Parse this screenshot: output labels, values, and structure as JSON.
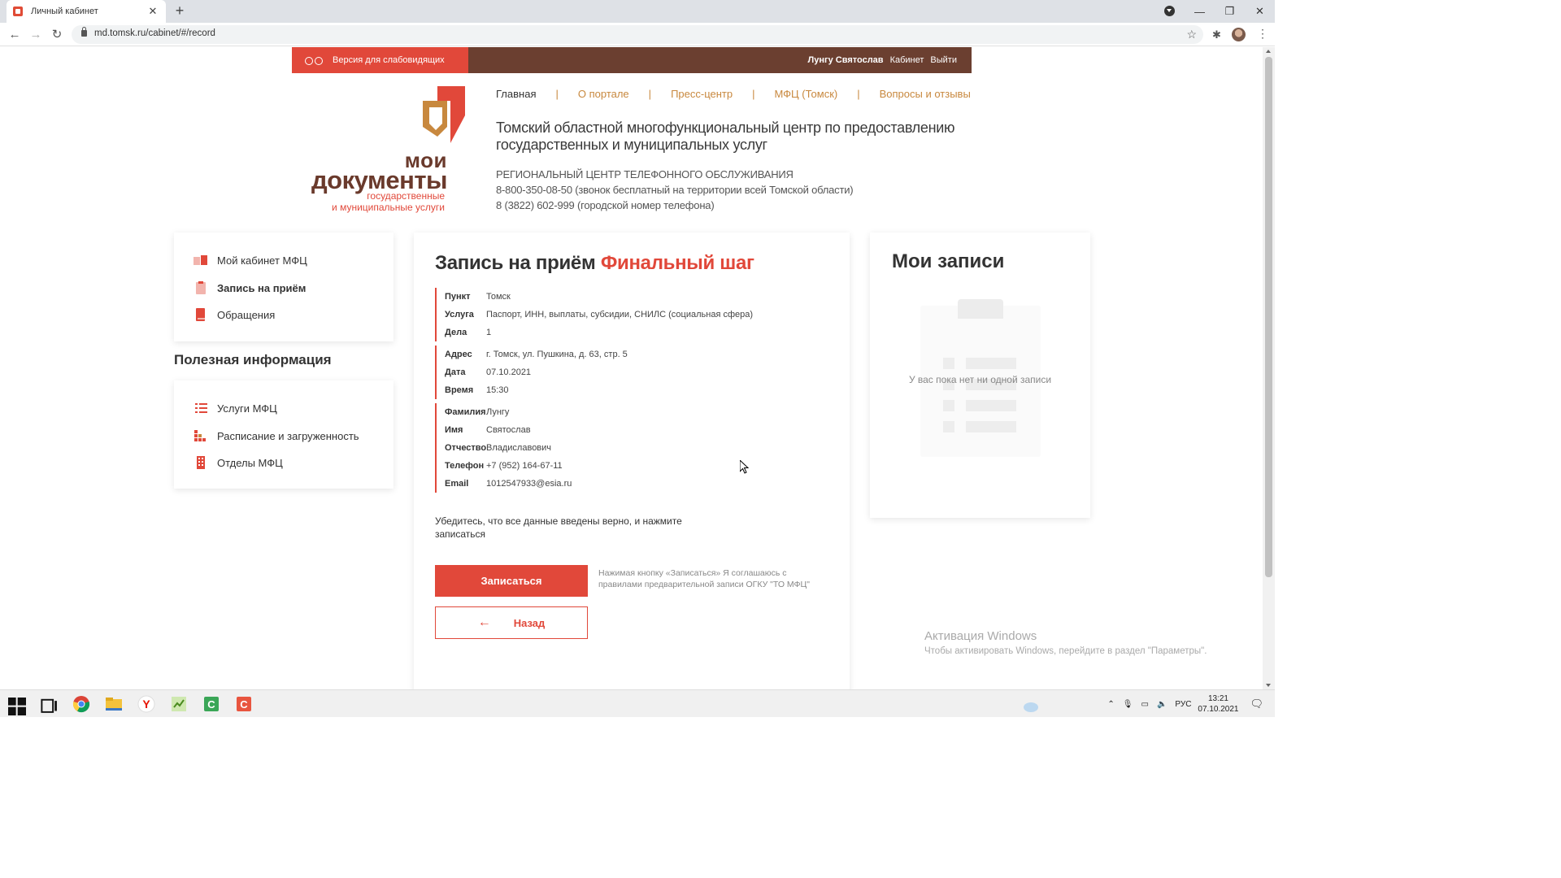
{
  "browser": {
    "tab_title": "Личный кабинет",
    "url": "md.tomsk.ru/cabinet/#/record"
  },
  "topbar": {
    "vision_label": "Версия для слабовидящих",
    "user_name": "Лунгу Святослав",
    "cabinet_link": "Кабинет",
    "logout_link": "Выйти"
  },
  "logo": {
    "line1": "мои",
    "line2": "документы",
    "line3": "государственные",
    "line4": "и муниципальные услуги"
  },
  "nav": {
    "items": [
      "Главная",
      "О портале",
      "Пресс-центр",
      "МФЦ (Томск)",
      "Вопросы и отзывы"
    ],
    "separator": "|"
  },
  "header": {
    "title": "Томский областной многофункциональный центр по предоставлению государственных и муниципальных услуг",
    "call_center": "РЕГИОНАЛЬНЫЙ ЦЕНТР ТЕЛЕФОННОГО ОБСЛУЖИВАНИЯ",
    "phone1": "8-800-350-08-50 (звонок бесплатный на территории всей Томской области)",
    "phone2": "8 (3822) 602-999 (городской номер телефона)"
  },
  "sidebar": {
    "items": [
      "Мой кабинет МФЦ",
      "Запись на приём",
      "Обращения"
    ],
    "useful_title": "Полезная информация",
    "useful_items": [
      "Услуги МФЦ",
      "Расписание и загруженность",
      "Отделы МФЦ"
    ]
  },
  "main": {
    "title": "Запись на приём",
    "title_accent": "Финальный шаг",
    "groups": [
      [
        [
          "Пункт",
          "Томск"
        ],
        [
          "Услуга",
          "Паспорт, ИНН, выплаты, субсидии, СНИЛС (социальная сфера)"
        ],
        [
          "Дела",
          "1"
        ]
      ],
      [
        [
          "Адрес",
          "г. Томск, ул. Пушкина, д. 63, стр. 5"
        ],
        [
          "Дата",
          "07.10.2021"
        ],
        [
          "Время",
          "15:30"
        ]
      ],
      [
        [
          "Фамилия",
          "Лунгу"
        ],
        [
          "Имя",
          "Святослав"
        ],
        [
          "Отчество",
          "Владиславович"
        ],
        [
          "Телефон",
          "+7 (952) 164-67-11"
        ],
        [
          "Email",
          "1012547933@esia.ru"
        ]
      ]
    ],
    "confirm_text": "Убедитесь, что все данные введены верно, и нажмите записаться",
    "submit_label": "Записаться",
    "back_label": "Назад",
    "agree_note": "Нажимая кнопку «Записаться» Я соглашаюсь с правилами предварительной записи ОГКУ \"ТО МФЦ\""
  },
  "records": {
    "title": "Мои записи",
    "empty_text": "У вас пока нет ни одной записи"
  },
  "watermark": {
    "line1": "Активация Windows",
    "line2": "Чтобы активировать Windows, перейдите в раздел \"Параметры\"."
  },
  "taskbar": {
    "lang": "РУС",
    "time": "13:21",
    "date": "07.10.2021"
  },
  "colors": {
    "accent": "#e1483a",
    "brown": "#6b3f30",
    "nav_link": "#c8883e"
  }
}
